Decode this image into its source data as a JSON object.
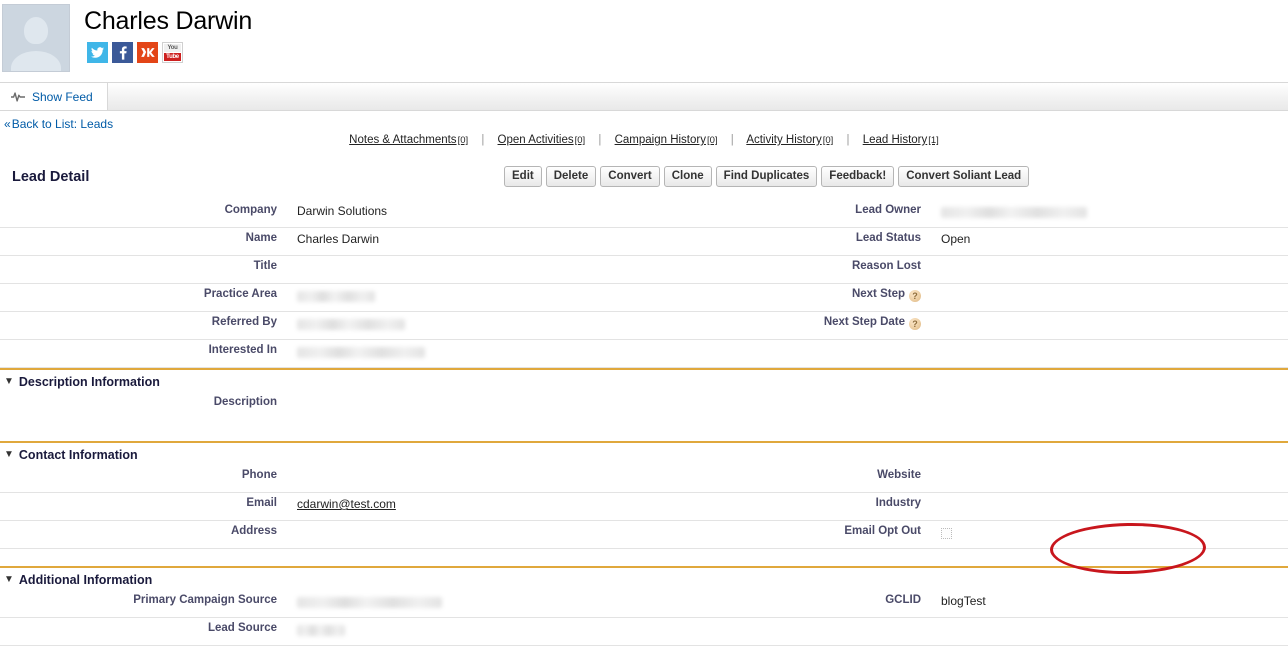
{
  "header": {
    "lead_name": "Charles Darwin",
    "avatar_name": "default-person-avatar",
    "social": [
      {
        "name": "twitter",
        "glyph": "ᴠ",
        "label": "Twitter"
      },
      {
        "name": "facebook",
        "glyph": "f",
        "label": "Facebook"
      },
      {
        "name": "klout",
        "glyph": "》K",
        "label": "Klout"
      },
      {
        "name": "youtube",
        "top": "You",
        "bottom": "Tube",
        "label": "YouTube"
      }
    ]
  },
  "feed_bar": {
    "show_feed_label": "Show Feed"
  },
  "back_link": {
    "chevron": "«",
    "label": "Back to List: Leads"
  },
  "quicklinks": {
    "separator": "|",
    "items": [
      {
        "label": "Notes & Attachments",
        "count": "[0]"
      },
      {
        "label": "Open Activities",
        "count": "[0]"
      },
      {
        "label": "Campaign History",
        "count": "[0]"
      },
      {
        "label": "Activity History",
        "count": "[0]"
      },
      {
        "label": "Lead History",
        "count": "[1]"
      }
    ]
  },
  "detail": {
    "title": "Lead Detail",
    "buttons": [
      "Edit",
      "Delete",
      "Convert",
      "Clone",
      "Find Duplicates",
      "Feedback!",
      "Convert Soliant Lead"
    ]
  },
  "fields": {
    "company_label": "Company",
    "company_value": "Darwin Solutions",
    "name_label": "Name",
    "name_value": "Charles Darwin",
    "title_label": "Title",
    "title_value": "",
    "practice_area_label": "Practice Area",
    "referred_by_label": "Referred By",
    "interested_in_label": "Interested In",
    "lead_owner_label": "Lead Owner",
    "lead_status_label": "Lead Status",
    "lead_status_value": "Open",
    "reason_lost_label": "Reason Lost",
    "reason_lost_value": "",
    "next_step_label": "Next Step",
    "next_step_value": "",
    "next_step_date_label": "Next Step Date",
    "next_step_date_value": "",
    "help_glyph": "?"
  },
  "description_section": {
    "toggle": "▼",
    "heading": "Description Information",
    "description_label": "Description",
    "description_value": ""
  },
  "contact_section": {
    "toggle": "▼",
    "heading": "Contact Information",
    "phone_label": "Phone",
    "phone_value": "",
    "email_label": "Email",
    "email_value": "cdarwin@test.com",
    "address_label": "Address",
    "address_value": "",
    "website_label": "Website",
    "website_value": "",
    "industry_label": "Industry",
    "industry_value": "",
    "email_opt_out_label": "Email Opt Out",
    "email_opt_out_checked": false
  },
  "additional_section": {
    "toggle": "▼",
    "heading": "Additional Information",
    "primary_campaign_source_label": "Primary Campaign Source",
    "lead_source_label": "Lead Source",
    "gclid_label": "GCLID",
    "gclid_value": "blogTest"
  },
  "annotation": {
    "shape": "oval",
    "color": "#c8161d",
    "targets": "GCLID field value"
  },
  "colors": {
    "link": "#015ba7",
    "section_rule": "#e0a83c",
    "annotation": "#c8161d",
    "label_text": "#4a4a68"
  }
}
